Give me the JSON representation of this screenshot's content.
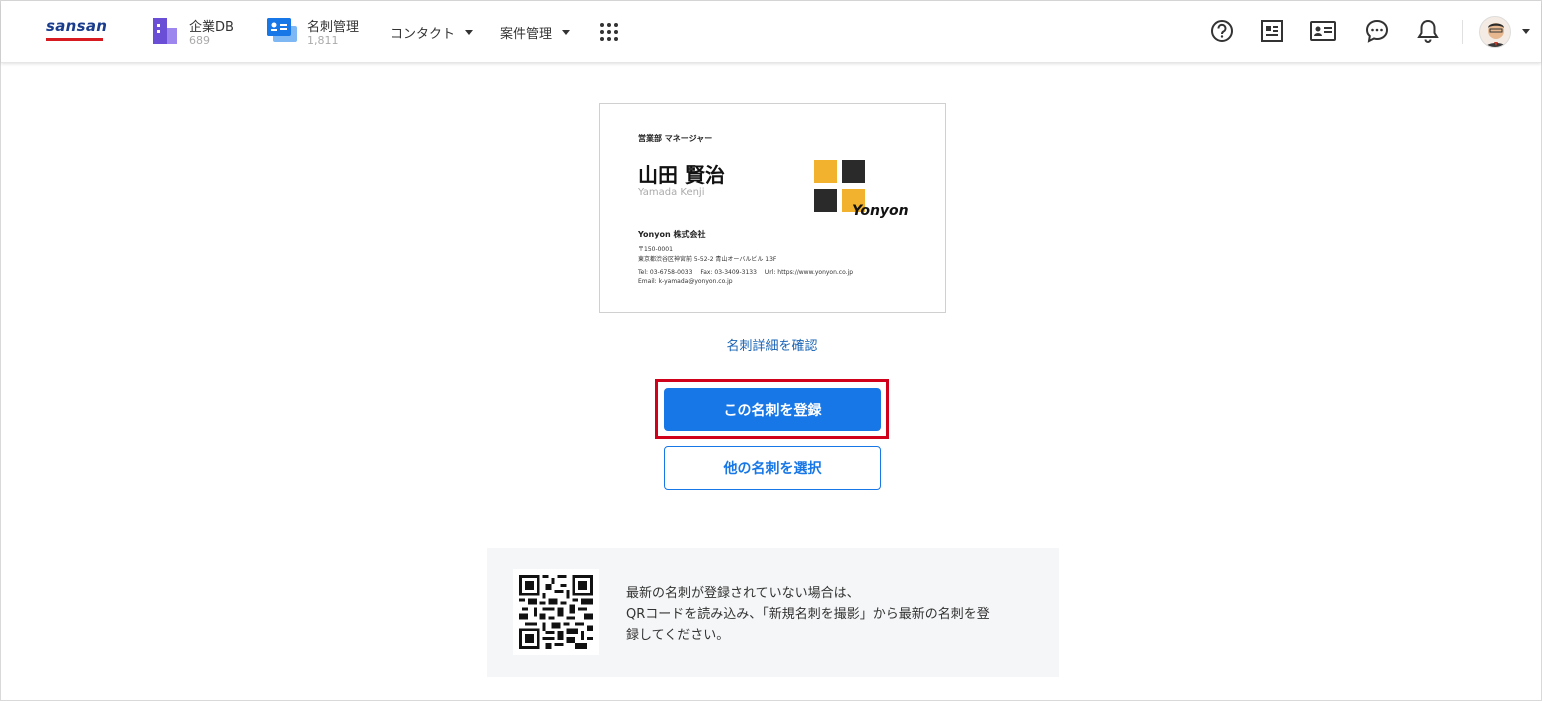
{
  "header": {
    "logo_text": "sansan",
    "apps": [
      {
        "label": "企業DB",
        "count": "689"
      },
      {
        "label": "名刺管理",
        "count": "1,811"
      }
    ],
    "menus": [
      {
        "label": "コンタクト"
      },
      {
        "label": "案件管理"
      }
    ],
    "icons": [
      "apps-grid-icon",
      "help-icon",
      "news-icon",
      "contact-card-icon",
      "chat-icon",
      "bell-icon"
    ]
  },
  "card": {
    "title": "営業部 マネージャー",
    "name": "山田 賢治",
    "name_roman": "Yamada Kenji",
    "company": "Yonyon 株式会社",
    "zip": "〒150-0001",
    "address": "東京都渋谷区神宮前 5-52-2 青山オーバルビル 13F",
    "contact_line": "Tel: 03-6758-0033　 Fax: 03-3409-3133　 Url: https://www.yonyon.co.jp",
    "email": "Email: k-yamada@yonyon.co.jp",
    "brand": "Yonyon"
  },
  "actions": {
    "detail_link": "名刺詳細を確認",
    "register_button": "この名刺を登録",
    "select_other_button": "他の名刺を選択"
  },
  "qr_panel": {
    "lines": [
      "最新の名刺が登録されていない場合は、",
      "QRコードを読み込み、「新規名刺を撮影」から最新の名刺を登",
      "録してください。"
    ]
  },
  "colors": {
    "primary": "#1877e6",
    "highlight": "#d0021b",
    "logo_blue": "#1a3c8c",
    "logo_red": "#d71920"
  }
}
